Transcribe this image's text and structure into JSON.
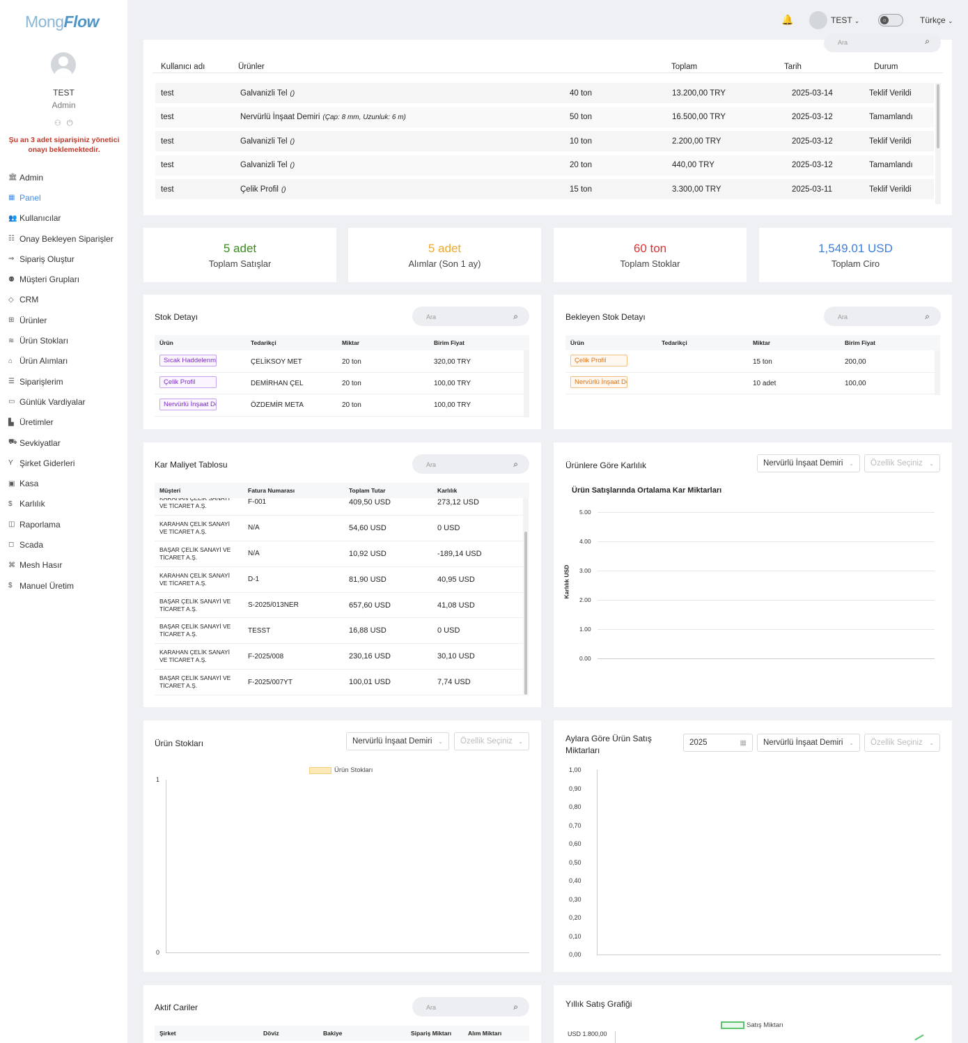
{
  "app": {
    "logo_a": "Mong",
    "logo_b": "Flow"
  },
  "user": {
    "name": "TEST",
    "role": "Admin"
  },
  "sidebar": {
    "warning": "Şu an 3 adet siparişiniz yönetici onayı beklemektedir.",
    "items": [
      {
        "label": "Admin",
        "icon": "🏛"
      },
      {
        "label": "Panel",
        "icon": "▦"
      },
      {
        "label": "Kullanıcılar",
        "icon": "👥"
      },
      {
        "label": "Onay Bekleyen Siparişler",
        "icon": "☷"
      },
      {
        "label": "Sipariş Oluştur",
        "icon": "⇒"
      },
      {
        "label": "Müşteri Grupları",
        "icon": "⚉"
      },
      {
        "label": "CRM",
        "icon": "◇"
      },
      {
        "label": "Ürünler",
        "icon": "⊞"
      },
      {
        "label": "Ürün Stokları",
        "icon": "≋"
      },
      {
        "label": "Ürün Alımları",
        "icon": "⌂"
      },
      {
        "label": "Siparişlerim",
        "icon": "☰"
      },
      {
        "label": "Günlük Vardiyalar",
        "icon": "▭"
      },
      {
        "label": "Üretimler",
        "icon": "▙"
      },
      {
        "label": "Sevkiyatlar",
        "icon": "⛟"
      },
      {
        "label": "Şirket Giderleri",
        "icon": "Y"
      },
      {
        "label": "Kasa",
        "icon": "▣"
      },
      {
        "label": "Karlılık",
        "icon": "$"
      },
      {
        "label": "Raporlama",
        "icon": "◫"
      },
      {
        "label": "Scada",
        "icon": "◻"
      },
      {
        "label": "Mesh Hasır",
        "icon": "⌘"
      },
      {
        "label": "Manuel Üretim",
        "icon": "$"
      }
    ]
  },
  "topbar": {
    "user": "TEST",
    "language": "Türkçe"
  },
  "search_placeholder": "Ara",
  "orders": {
    "headers": [
      "Kullanıcı adı",
      "Ürünler",
      "Toplam",
      "Tarih",
      "Durum"
    ],
    "rows": [
      {
        "user": "test",
        "product": "Galvanizli Tel",
        "spec": "()",
        "qty": "40 ton",
        "total": "13.200,00 TRY",
        "date": "2025-03-14",
        "status": "Teklif Verildi"
      },
      {
        "user": "test",
        "product": "Nervürlü İnşaat Demiri",
        "spec": "(Çap: 8 mm, Uzunluk: 6 m)",
        "qty": "50 ton",
        "total": "16.500,00 TRY",
        "date": "2025-03-12",
        "status": "Tamamlandı"
      },
      {
        "user": "test",
        "product": "Galvanizli Tel",
        "spec": "()",
        "qty": "10 ton",
        "total": "2.200,00 TRY",
        "date": "2025-03-12",
        "status": "Teklif Verildi"
      },
      {
        "user": "test",
        "product": "Galvanizli Tel",
        "spec": "()",
        "qty": "20 ton",
        "total": "440,00 TRY",
        "date": "2025-03-12",
        "status": "Tamamlandı"
      },
      {
        "user": "test",
        "product": "Çelik Profil",
        "spec": "()",
        "qty": "15 ton",
        "total": "3.300,00 TRY",
        "date": "2025-03-11",
        "status": "Teklif Verildi"
      }
    ]
  },
  "kpis": [
    {
      "value": "5 adet",
      "label": "Toplam Satışlar",
      "color": "#3a8a1f"
    },
    {
      "value": "5 adet",
      "label": "Alımlar (Son 1 ay)",
      "color": "#f0a830"
    },
    {
      "value": "60 ton",
      "label": "Toplam Stoklar",
      "color": "#e03131"
    },
    {
      "value": "1,549.01 USD",
      "label": "Toplam Ciro",
      "color": "#3d7ee0"
    }
  ],
  "stock": {
    "title": "Stok Detayı",
    "headers": [
      "Ürün",
      "Tedarikçi",
      "Miktar",
      "Birim Fiyat"
    ],
    "rows": [
      {
        "product": "Sıcak Haddelenmiş",
        "supplier": "ÇELİKSOY MET",
        "qty": "20 ton",
        "price": "320,00 TRY"
      },
      {
        "product": "Çelik Profil",
        "supplier": "DEMİRHAN ÇEL",
        "qty": "20 ton",
        "price": "100,00 TRY"
      },
      {
        "product": "Nervürlü İnşaat Demiri",
        "supplier": "ÖZDEMİR META",
        "qty": "20 ton",
        "price": "100,00 TRY"
      }
    ]
  },
  "pending_stock": {
    "title": "Bekleyen Stok Detayı",
    "headers": [
      "Ürün",
      "Tedarikçi",
      "Miktar",
      "Birim Fiyat"
    ],
    "rows": [
      {
        "product": "Çelik Profil",
        "supplier": "",
        "qty": "15 ton",
        "price": "200,00"
      },
      {
        "product": "Nervürlü İnşaat Demiri",
        "supplier": "",
        "qty": "10 adet",
        "price": "100,00"
      }
    ]
  },
  "profit_table": {
    "title": "Kar Maliyet Tablosu",
    "headers": [
      "Müşteri",
      "Fatura Numarası",
      "Toplam Tutar",
      "Karlılık"
    ],
    "rows": [
      {
        "customer": "KARAHAN ÇELİK SANAYİ VE TİCARET A.Ş.",
        "invoice": "F-001",
        "total": "409,50 USD",
        "profit": "273,12 USD"
      },
      {
        "customer": "KARAHAN ÇELİK SANAYİ VE TİCARET A.Ş.",
        "invoice": "N/A",
        "total": "54,60 USD",
        "profit": "0 USD"
      },
      {
        "customer": "BAŞAR ÇELİK SANAYİ VE TİCARET A.Ş.",
        "invoice": "N/A",
        "total": "10,92 USD",
        "profit": "-189,14 USD"
      },
      {
        "customer": "KARAHAN ÇELİK SANAYİ VE TİCARET A.Ş.",
        "invoice": "D-1",
        "total": "81,90 USD",
        "profit": "40,95 USD"
      },
      {
        "customer": "BAŞAR ÇELİK SANAYİ VE TİCARET A.Ş.",
        "invoice": "S-2025/013NER",
        "total": "657,60 USD",
        "profit": "41,08 USD"
      },
      {
        "customer": "BAŞAR ÇELİK SANAYİ VE TİCARET A.Ş.",
        "invoice": "TESST",
        "total": "16,88 USD",
        "profit": "0 USD"
      },
      {
        "customer": "KARAHAN ÇELİK SANAYİ VE TİCARET A.Ş.",
        "invoice": "F-2025/008",
        "total": "230,16 USD",
        "profit": "30,10 USD"
      },
      {
        "customer": "BAŞAR ÇELİK SANAYİ VE TİCARET A.Ş.",
        "invoice": "F-2025/007YT",
        "total": "100,01 USD",
        "profit": "7,74 USD"
      }
    ]
  },
  "profit_chart": {
    "title": "Ürünlere Göre Karlılık",
    "product_select": "Nervürlü İnşaat Demiri",
    "feature_placeholder": "Özellik Seçiniz"
  },
  "stock_chart": {
    "title": "Ürün Stokları",
    "product_select": "Nervürlü İnşaat Demiri",
    "feature_placeholder": "Özellik Seçiniz"
  },
  "monthly_chart": {
    "title": "Aylara Göre Ürün Satış Miktarları",
    "year": "2025",
    "product_select": "Nervürlü İnşaat Demiri",
    "feature_placeholder": "Özellik Seçiniz"
  },
  "accounts": {
    "title": "Aktif Cariler",
    "headers": [
      "Şirket",
      "Döviz",
      "Bakiye",
      "Sipariş Miktarı",
      "Alım Miktarı"
    ]
  },
  "yearly_chart": {
    "title": "Yıllık Satış Grafiği"
  },
  "chart_data": [
    {
      "type": "line",
      "title": "Ürün Satışlarında Ortalama Kar Miktarları",
      "ylabel": "Karlılık USD",
      "ylim": [
        0,
        5
      ],
      "yticks": [
        "5.00",
        "4.00",
        "3.00",
        "2.00",
        "1.00",
        "0.00"
      ],
      "series": []
    },
    {
      "type": "bar",
      "title": "",
      "legend": "Ürün Stokları",
      "ylim": [
        0,
        1
      ],
      "yticks": [
        "1",
        "0"
      ],
      "series": [
        {
          "name": "Ürün Stokları",
          "values": []
        }
      ]
    },
    {
      "type": "line",
      "title": "",
      "ylim": [
        0,
        1
      ],
      "yticks": [
        "1,00",
        "0,90",
        "0,80",
        "0,70",
        "0,60",
        "0,50",
        "0,40",
        "0,30",
        "0,20",
        "0,10",
        "0,00"
      ],
      "series": []
    },
    {
      "type": "line",
      "title": "",
      "legend": "Satış Miktarı",
      "ytick_top": "USD 1.800,00",
      "series": [
        {
          "name": "Satış Miktarı",
          "values": []
        }
      ]
    }
  ]
}
